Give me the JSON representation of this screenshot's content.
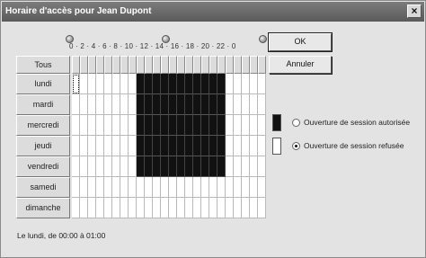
{
  "window": {
    "title": "Horaire d'accès pour Jean Dupont",
    "close_glyph": "×"
  },
  "buttons": {
    "ok": "OK",
    "cancel": "Annuler"
  },
  "hour_ruler": "0 · 2 · 4 · 6 · 8 · 10 · 12 · 14 · 16 · 18 · 20 · 22 · 0",
  "grid": {
    "all_label": "Tous",
    "days": [
      "lundi",
      "mardi",
      "mercredi",
      "jeudi",
      "vendredi",
      "samedi",
      "dimanche"
    ],
    "permitted": [
      [
        8,
        9,
        10,
        11,
        12,
        13,
        14,
        15,
        16,
        17,
        18
      ],
      [
        8,
        9,
        10,
        11,
        12,
        13,
        14,
        15,
        16,
        17,
        18
      ],
      [
        8,
        9,
        10,
        11,
        12,
        13,
        14,
        15,
        16,
        17,
        18
      ],
      [
        8,
        9,
        10,
        11,
        12,
        13,
        14,
        15,
        16,
        17,
        18
      ],
      [
        8,
        9,
        10,
        11,
        12,
        13,
        14,
        15,
        16,
        17,
        18
      ],
      [],
      []
    ],
    "selected_cell": {
      "day": 0,
      "hour": 0
    }
  },
  "legend": {
    "allowed_label": "Ouverture de session autorisée",
    "denied_label": "Ouverture de session refusée",
    "allowed_color": "#111111",
    "denied_color": "#ffffff",
    "checked": "denied"
  },
  "status_text": "Le lundi, de 00:00 à 01:00",
  "icons": {
    "knob": "slider-knob-icon",
    "close": "close-icon"
  }
}
